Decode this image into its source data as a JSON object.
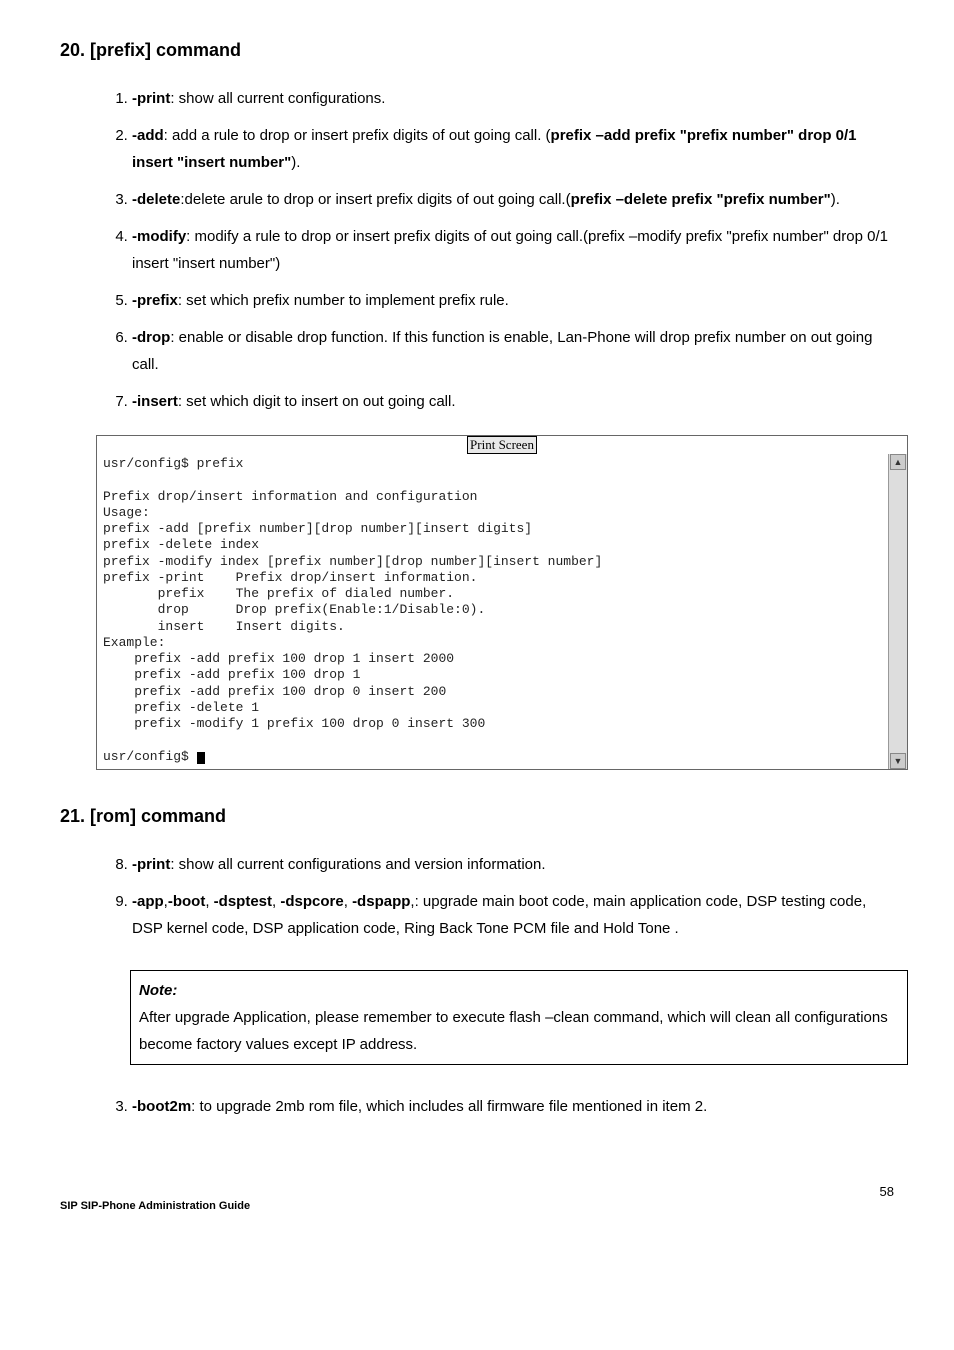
{
  "section20": {
    "heading": "20. [prefix] command",
    "items": [
      {
        "prefix": "-print",
        "text": ": show all current configurations."
      },
      {
        "prefix": "-add",
        "text": ": add a rule to drop or insert prefix digits of out going call. (",
        "bold2": "prefix –add prefix \"prefix number\" drop 0/1 insert \"insert number\"",
        "tail": ")."
      },
      {
        "prefix": "-delete",
        "text": ":delete arule to drop or insert prefix digits of out going call.(",
        "bold2": "prefix –delete prefix \"prefix number\"",
        "tail": ")."
      },
      {
        "prefix": "-modify",
        "text": ": modify a rule to drop or insert prefix digits of out going call.(prefix –modify prefix \"prefix number\" drop 0/1 insert \"insert number\")"
      },
      {
        "prefix": "-prefix",
        "text": ": set which prefix number to implement prefix rule."
      },
      {
        "prefix": "-drop",
        "text": ": enable or disable drop function. If this function is enable, Lan-Phone will drop prefix number on out going call."
      },
      {
        "prefix": "-insert",
        "text": ": set which digit to insert on out going call."
      }
    ]
  },
  "terminal": {
    "print_screen": "Print Screen",
    "lines": "usr/config$ prefix\n\nPrefix drop/insert information and configuration\nUsage:\nprefix -add [prefix number][drop number][insert digits]\nprefix -delete index\nprefix -modify index [prefix number][drop number][insert number]\nprefix -print    Prefix drop/insert information.\n       prefix    The prefix of dialed number.\n       drop      Drop prefix(Enable:1/Disable:0).\n       insert    Insert digits.\nExample:\n    prefix -add prefix 100 drop 1 insert 2000\n    prefix -add prefix 100 drop 1\n    prefix -add prefix 100 drop 0 insert 200\n    prefix -delete 1\n    prefix -modify 1 prefix 100 drop 0 insert 300\n\nusr/config$ "
  },
  "section21": {
    "heading": "21. [rom] command",
    "items8": {
      "prefix": "-print",
      "text": ": show all current configurations and version information."
    },
    "items9": {
      "bolds": [
        "-app",
        "-boot",
        "-dsptest",
        "-dspcore",
        "-dspapp"
      ],
      "text": ",: upgrade main boot code, main application code, DSP testing code, DSP kernel code, DSP application code, Ring Back Tone PCM file and Hold Tone ."
    }
  },
  "note": {
    "title": "Note:",
    "body": "After upgrade Application, please remember to execute flash –clean command, which will clean all configurations become factory values except IP address."
  },
  "item3": {
    "num": "3.",
    "prefix": "-boot2m",
    "text": ": to upgrade 2mb rom file, which includes all firmware file mentioned in item 2."
  },
  "footer": {
    "left": "SIP SIP-Phone    Administration Guide",
    "right": "58"
  }
}
